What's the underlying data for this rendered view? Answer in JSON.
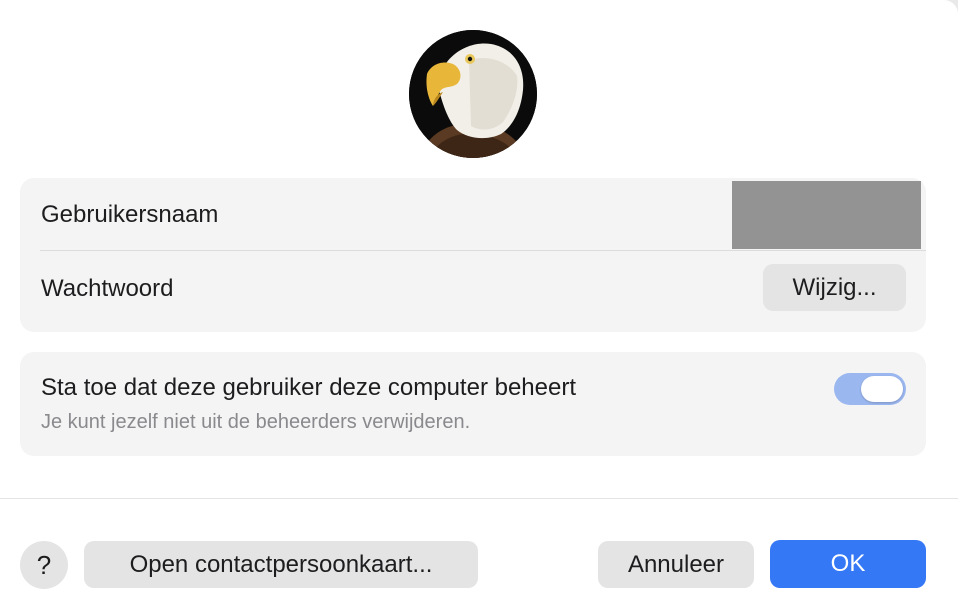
{
  "avatar": {
    "icon": "bald-eagle-photo"
  },
  "account": {
    "username_label": "Gebruikersnaam",
    "password_label": "Wachtwoord",
    "change_button": "Wijzig..."
  },
  "admin": {
    "label": "Sta toe dat deze gebruiker deze computer beheert",
    "sublabel": "Je kunt jezelf niet uit de beheerders verwijderen.",
    "toggle_on": true,
    "toggle_color": "#9bb7f0"
  },
  "footer": {
    "help_label": "?",
    "contact_button": "Open contactpersoonkaart...",
    "cancel_button": "Annuleer",
    "ok_button": "OK",
    "ok_color": "#3478f6"
  }
}
